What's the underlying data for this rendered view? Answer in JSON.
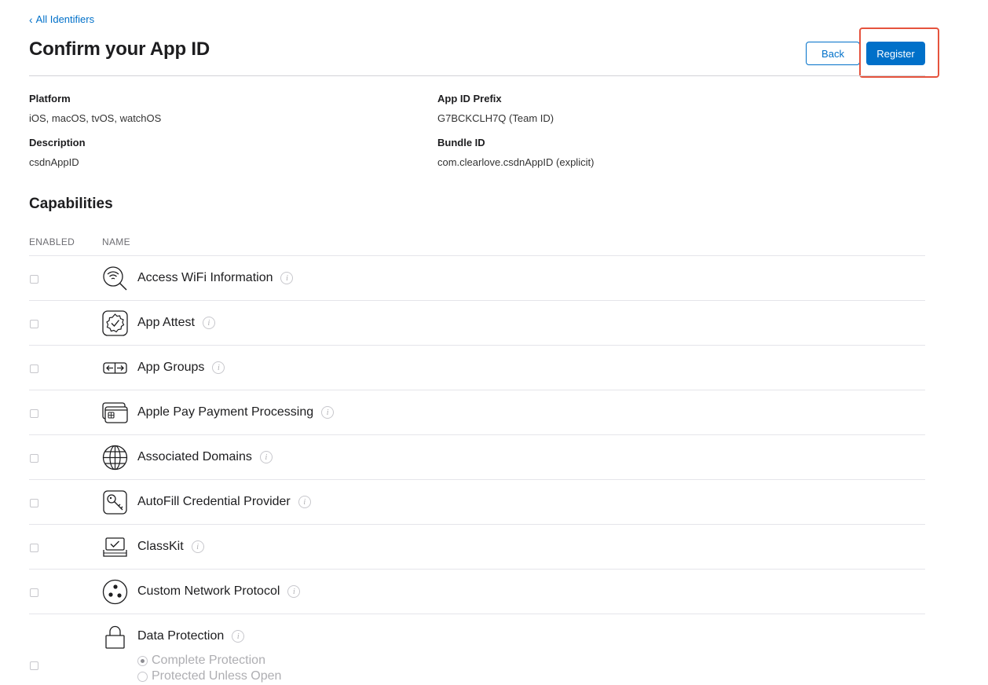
{
  "nav": {
    "back_link": "All Identifiers"
  },
  "page": {
    "title": "Confirm your App ID"
  },
  "actions": {
    "back_label": "Back",
    "register_label": "Register"
  },
  "details": {
    "platform_label": "Platform",
    "platform_value": "iOS, macOS, tvOS, watchOS",
    "prefix_label": "App ID Prefix",
    "prefix_value": "G7BCKCLH7Q (Team ID)",
    "description_label": "Description",
    "description_value": "csdnAppID",
    "bundle_label": "Bundle ID",
    "bundle_value": "com.clearlove.csdnAppID (explicit)"
  },
  "capabilities": {
    "title": "Capabilities",
    "col_enabled": "ENABLED",
    "col_name": "NAME",
    "items": [
      {
        "name": "Access WiFi Information",
        "icon": "wifi-search-icon",
        "enabled": false
      },
      {
        "name": "App Attest",
        "icon": "badge-check-icon",
        "enabled": false
      },
      {
        "name": "App Groups",
        "icon": "app-groups-icon",
        "enabled": false
      },
      {
        "name": "Apple Pay Payment Processing",
        "icon": "credit-card-icon",
        "enabled": false
      },
      {
        "name": "Associated Domains",
        "icon": "globe-icon",
        "enabled": false
      },
      {
        "name": "AutoFill Credential Provider",
        "icon": "key-icon",
        "enabled": false
      },
      {
        "name": "ClassKit",
        "icon": "classkit-icon",
        "enabled": false
      },
      {
        "name": "Custom Network Protocol",
        "icon": "network-dots-icon",
        "enabled": false
      },
      {
        "name": "Data Protection",
        "icon": "lock-icon",
        "enabled": false,
        "options": [
          {
            "label": "Complete Protection",
            "selected": true
          },
          {
            "label": "Protected Unless Open",
            "selected": false
          }
        ]
      }
    ]
  },
  "colors": {
    "accent": "#0070c9",
    "highlight": "#e5533d"
  }
}
